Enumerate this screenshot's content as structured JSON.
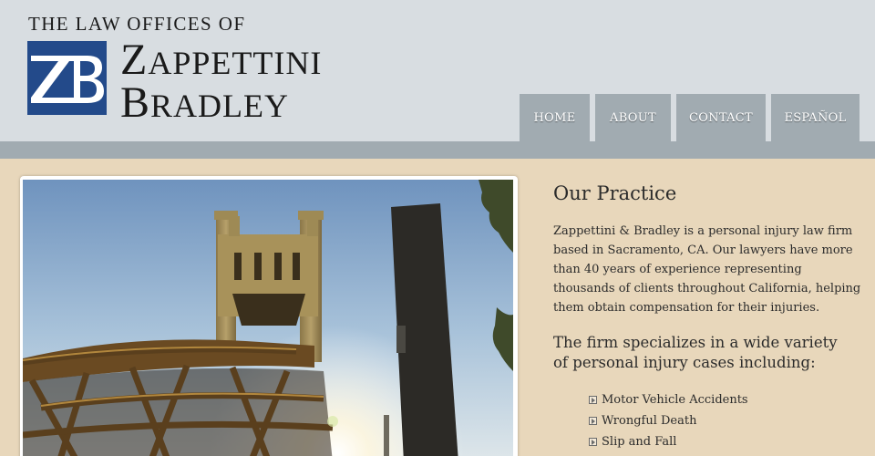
{
  "header": {
    "tagline": "THE LAW OFFICES OF",
    "logo_initials": "ZB",
    "name_line1_initial": "Z",
    "name_line1_rest": "APPETTINI",
    "name_line2_initial": "B",
    "name_line2_rest": "RADLEY"
  },
  "nav": {
    "items": [
      {
        "label": "HOME"
      },
      {
        "label": "ABOUT"
      },
      {
        "label": "CONTACT"
      },
      {
        "label": "ESPAÑOL"
      }
    ]
  },
  "main": {
    "photo_icon": "tower-bridge-photo",
    "title": "Our Practice",
    "body": "Zappettini & Bradley is a personal injury law firm based in Sacramento, CA. Our lawyers have more than 40 years of experience representing thousands of clients throughout California, helping them obtain compensation for their injuries.",
    "specialize_heading": "The firm specializes in a wide variety of personal injury cases including:",
    "cases": [
      {
        "label": "Motor Vehicle Accidents"
      },
      {
        "label": "Wrongful Death"
      },
      {
        "label": "Slip and Fall"
      }
    ]
  },
  "colors": {
    "header_bg": "#d8dde1",
    "nav_bg": "#a1abb1",
    "page_bg": "#e8d7bb",
    "logo_blue": "#234a8a"
  }
}
